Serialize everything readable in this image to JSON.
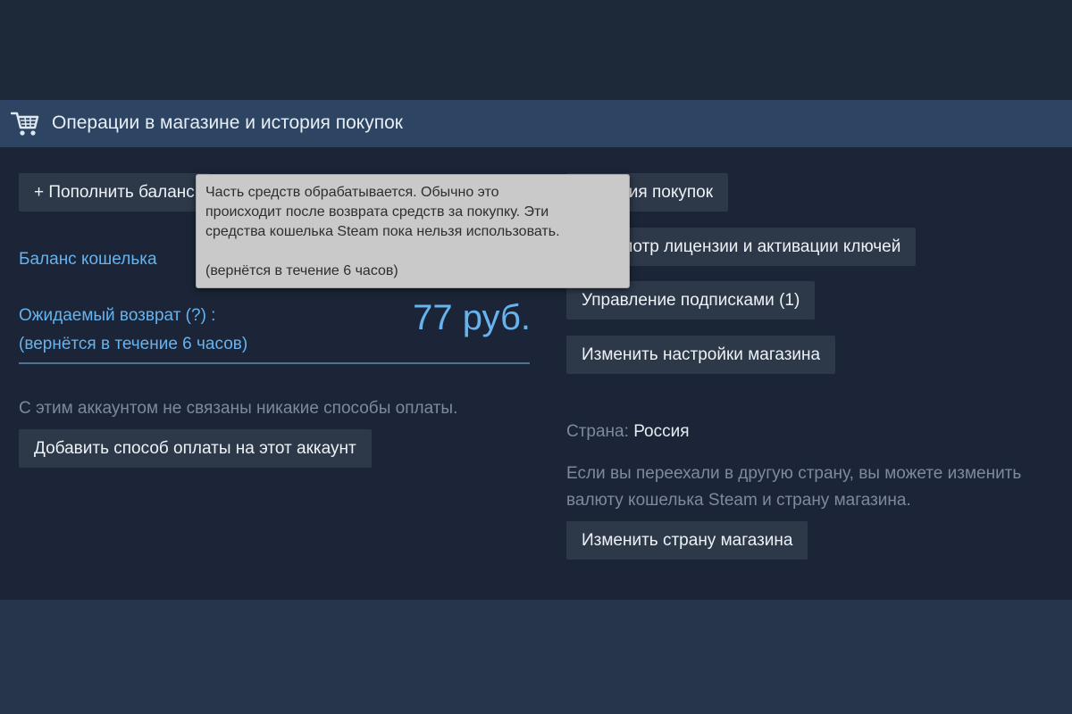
{
  "header": {
    "title": "Операции в магазине и история покупок",
    "icon": "shopping-cart-icon"
  },
  "left": {
    "add_funds_label": "+ Пополнить баланс",
    "wallet_balance_label": "Баланс кошелька",
    "pending_refund_label": "Ожидаемый возврат (?) :",
    "pending_refund_note": "(вернётся в течение 6 часов)",
    "pending_refund_amount": "77 руб.",
    "no_payment_text": "С этим аккаунтом не связаны никакие способы оплаты.",
    "add_payment_label": "Добавить способ оплаты на этот аккаунт"
  },
  "right": {
    "purchase_history_label": "История покупок",
    "license_label": "Просмотр лицензии и активации ключей",
    "subscriptions_label": "Управление подписками (1)",
    "store_prefs_label": "Изменить настройки магазина",
    "country_label": "Страна:",
    "country_value": "Россия",
    "move_text": "Если вы переехали в другую страну, вы можете изменить валюту кошелька Steam и страну магазина.",
    "change_country_label": "Изменить страну магазина"
  },
  "tooltip": {
    "line1": "Часть средств обрабатывается. Обычно это",
    "line2": "происходит после возврата средств за покупку. Эти",
    "line3": "средства кошелька Steam пока нельзя использовать.",
    "note": "(вернётся в течение 6 часов)"
  },
  "colors": {
    "accent": "#66b3ee",
    "header_bg": "#2d4563",
    "panel_bg": "#1b2537",
    "button_bg": "#2d3849",
    "tooltip_bg": "#c9c9c9"
  }
}
